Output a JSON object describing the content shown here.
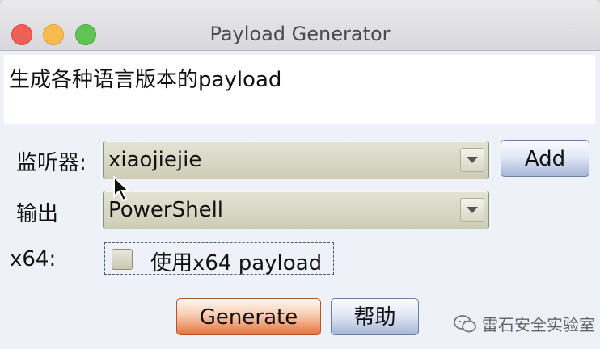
{
  "window": {
    "title": "Payload Generator"
  },
  "description": "生成各种语言版本的payload",
  "form": {
    "listener": {
      "label": "监听器:",
      "value": "xiaojiejie",
      "add_label": "Add"
    },
    "output": {
      "label": "输出",
      "value": "PowerShell"
    },
    "x64": {
      "label": "x64:",
      "checkbox_label": "使用x64 payload",
      "checked": false
    }
  },
  "buttons": {
    "generate_label": "Generate",
    "help_label": "帮助"
  },
  "watermark": {
    "text": "雷石安全实验室"
  },
  "icons": {
    "combo_arrow": "chevron-down-icon",
    "cursor": "mouse-cursor-icon",
    "watermark": "wechat-icon"
  }
}
